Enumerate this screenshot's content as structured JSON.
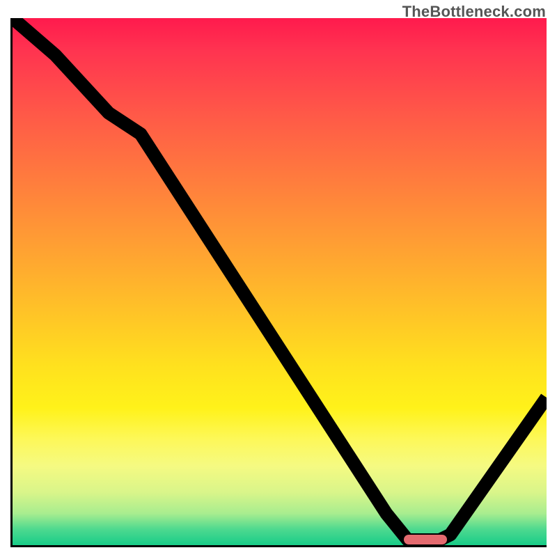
{
  "watermark": "TheBottleneck.com",
  "chart_data": {
    "type": "line",
    "title": "",
    "xlabel": "",
    "ylabel": "",
    "xlim": [
      0,
      100
    ],
    "ylim": [
      0,
      100
    ],
    "x": [
      0,
      8,
      18,
      24,
      70,
      74,
      80,
      82,
      100
    ],
    "values": [
      100,
      93,
      82,
      78,
      6,
      1,
      1,
      2,
      28
    ],
    "marker": {
      "x_start": 73,
      "x_end": 81,
      "y": 1.5
    },
    "gradient_stops": [
      {
        "pct": 0,
        "hex": "#ff1a4d"
      },
      {
        "pct": 18,
        "hex": "#ff5848"
      },
      {
        "pct": 42,
        "hex": "#ff9c34"
      },
      {
        "pct": 66,
        "hex": "#ffe11e"
      },
      {
        "pct": 85,
        "hex": "#f5fa82"
      },
      {
        "pct": 100,
        "hex": "#18cc88"
      }
    ]
  }
}
